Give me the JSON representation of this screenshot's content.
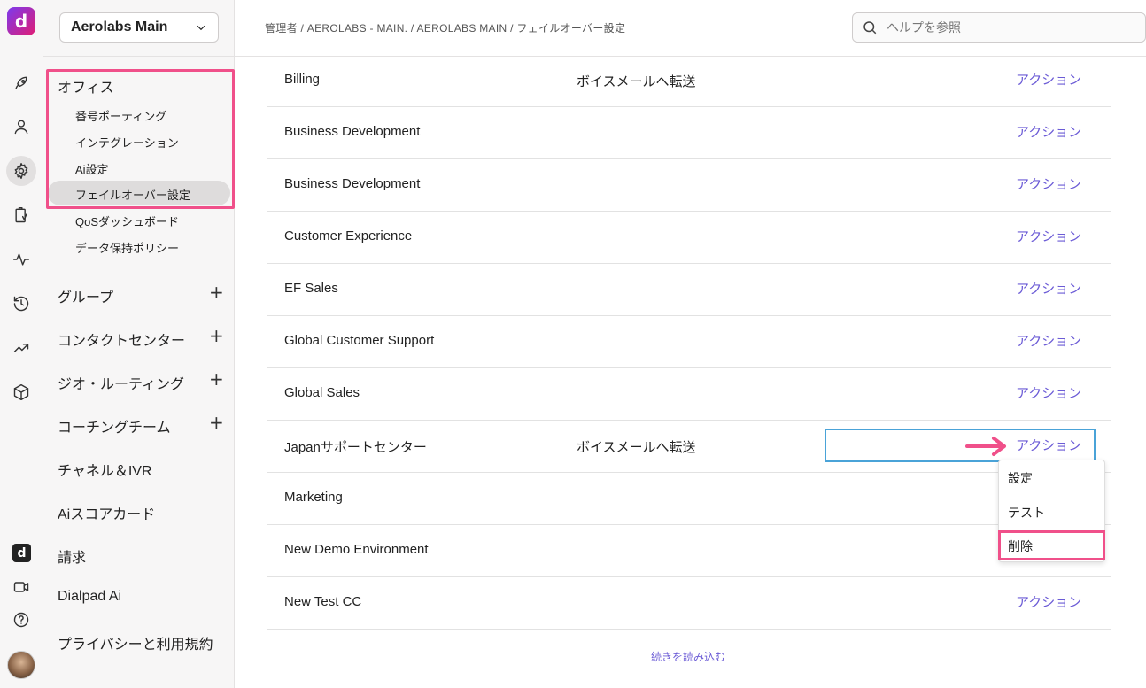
{
  "app": {
    "logo_letter": "d",
    "accent_color": "#6b5bd6",
    "highlight_color": "#f0508a"
  },
  "rail": {
    "icons": [
      "rocket-icon",
      "user-icon",
      "gear-icon",
      "clipboard-icon",
      "activity-icon",
      "history-icon",
      "trending-icon",
      "cube-icon",
      "dialpad-logo-icon",
      "video-icon",
      "help-icon"
    ],
    "dlogo_letter": "d"
  },
  "sidebar": {
    "office_selector": "Aerolabs Main",
    "office_section": "オフィス",
    "office_items": [
      "番号ポーティング",
      "インテグレーション",
      "Ai設定",
      "フェイルオーバー設定",
      "QoSダッシュボード",
      "データ保持ポリシー"
    ],
    "sections": [
      {
        "label": "グループ",
        "expandable": true
      },
      {
        "label": "コンタクトセンター",
        "expandable": true
      },
      {
        "label": "ジオ・ルーティング",
        "expandable": true
      },
      {
        "label": "コーチングチーム",
        "expandable": true
      },
      {
        "label": "チャネル＆IVR",
        "expandable": false
      },
      {
        "label": "Aiスコアカード",
        "expandable": false
      },
      {
        "label": "請求",
        "expandable": false
      },
      {
        "label": "Dialpad Ai",
        "expandable": false
      },
      {
        "label": "プライバシーと利用規約",
        "expandable": false
      }
    ],
    "plus_symbol": "+"
  },
  "header": {
    "breadcrumb": "管理者 / AEROLABS - MAIN. / AEROLABS MAIN / フェイルオーバー設定",
    "search_placeholder": "ヘルプを参照"
  },
  "table": {
    "rows": [
      {
        "name": "Billing",
        "routing": "ボイスメールへ転送",
        "action": "アクション"
      },
      {
        "name": "Business Development",
        "routing": "",
        "action": "アクション"
      },
      {
        "name": "Business Development",
        "routing": "",
        "action": "アクション"
      },
      {
        "name": "Customer Experience",
        "routing": "",
        "action": "アクション"
      },
      {
        "name": "EF Sales",
        "routing": "",
        "action": "アクション"
      },
      {
        "name": "Global Customer Support",
        "routing": "",
        "action": "アクション"
      },
      {
        "name": "Global Sales",
        "routing": "",
        "action": "アクション"
      },
      {
        "name": "Japanサポートセンター",
        "routing": "ボイスメールへ転送",
        "action": "アクション"
      },
      {
        "name": "Marketing",
        "routing": "",
        "action": ""
      },
      {
        "name": "New Demo Environment",
        "routing": "",
        "action": ""
      },
      {
        "name": "New Test CC",
        "routing": "",
        "action": "アクション"
      }
    ],
    "load_more": "続きを読み込む"
  },
  "action_menu": {
    "items": [
      "設定",
      "テスト",
      "削除"
    ]
  }
}
